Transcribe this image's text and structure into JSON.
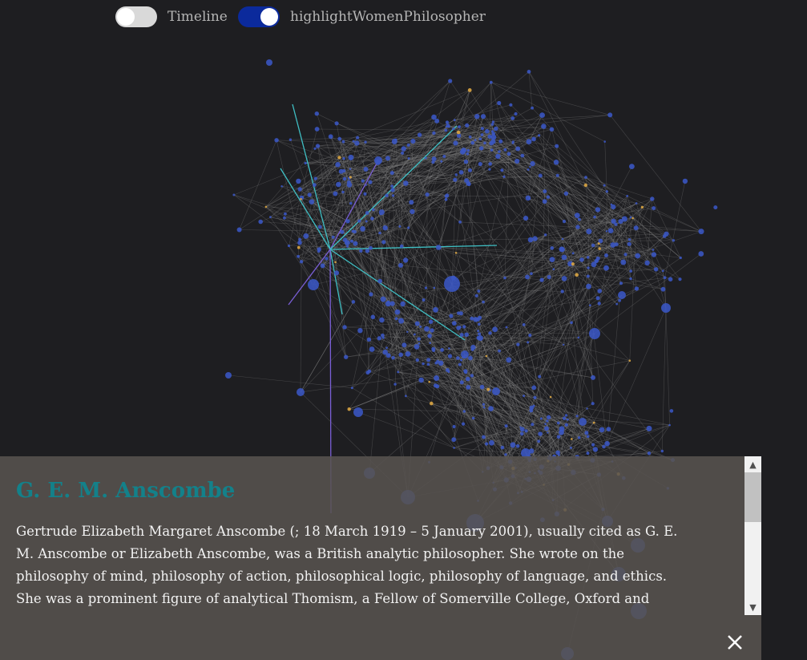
{
  "controls": {
    "timeline": {
      "label": "Timeline",
      "enabled": false
    },
    "highlight_women": {
      "label": "highlightWomenPhilosopher",
      "enabled": true
    }
  },
  "graph": {
    "colors": {
      "background": "#1e1e21",
      "edge": "#8a8a8a",
      "node": "#3a57c4",
      "women_node": "#d9a441",
      "highlight_edge": "#3fbfc4",
      "highlight_edge_alt": "#7a5fd6"
    }
  },
  "info_panel": {
    "name": "G. E. M. Anscombe",
    "bio": "Gertrude Elizabeth Margaret Anscombe (; 18 March 1919 – 5 January 2001), usually cited as G. E. M. Anscombe or Elizabeth Anscombe, was a British analytic philosopher. She wrote on the philosophy of mind, philosophy of action, philosophical logic, philosophy of language, and ethics. She was a prominent figure of analytical Thomism, a Fellow of Somerville College, Oxford and Professor of Philosophy at the University of",
    "name_color": "#13818a"
  },
  "icons": {
    "close": "close-icon",
    "scroll_up": "chevron-up-icon",
    "scroll_down": "chevron-down-icon"
  }
}
